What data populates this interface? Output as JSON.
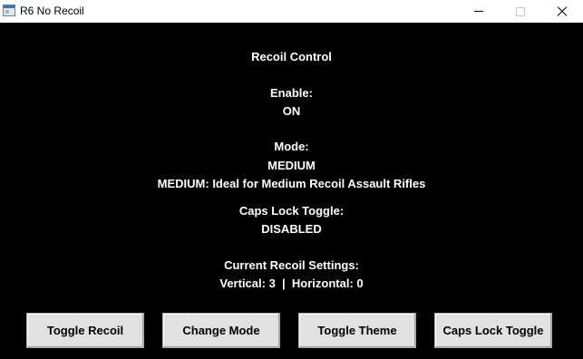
{
  "window": {
    "title": "R6 No Recoil",
    "icon": "app-window-icon"
  },
  "content": {
    "heading": "Recoil Control",
    "enable_label": "Enable:",
    "enable_value": "ON",
    "mode_label": "Mode:",
    "mode_value": "MEDIUM",
    "mode_description": "MEDIUM: Ideal for Medium Recoil Assault Rifles",
    "caps_label": "Caps Lock Toggle:",
    "caps_value": "DISABLED",
    "settings_label": "Current Recoil Settings:",
    "settings_value": "Vertical: 3  |  Horizontal: 0"
  },
  "buttons": [
    {
      "label": "Toggle Recoil"
    },
    {
      "label": "Change Mode"
    },
    {
      "label": "Toggle Theme"
    },
    {
      "label": "Caps Lock Toggle"
    }
  ],
  "colors": {
    "background": "#000000",
    "text": "#ffffff",
    "button_face": "#e1e1e1",
    "titlebar": "#ffffff"
  }
}
